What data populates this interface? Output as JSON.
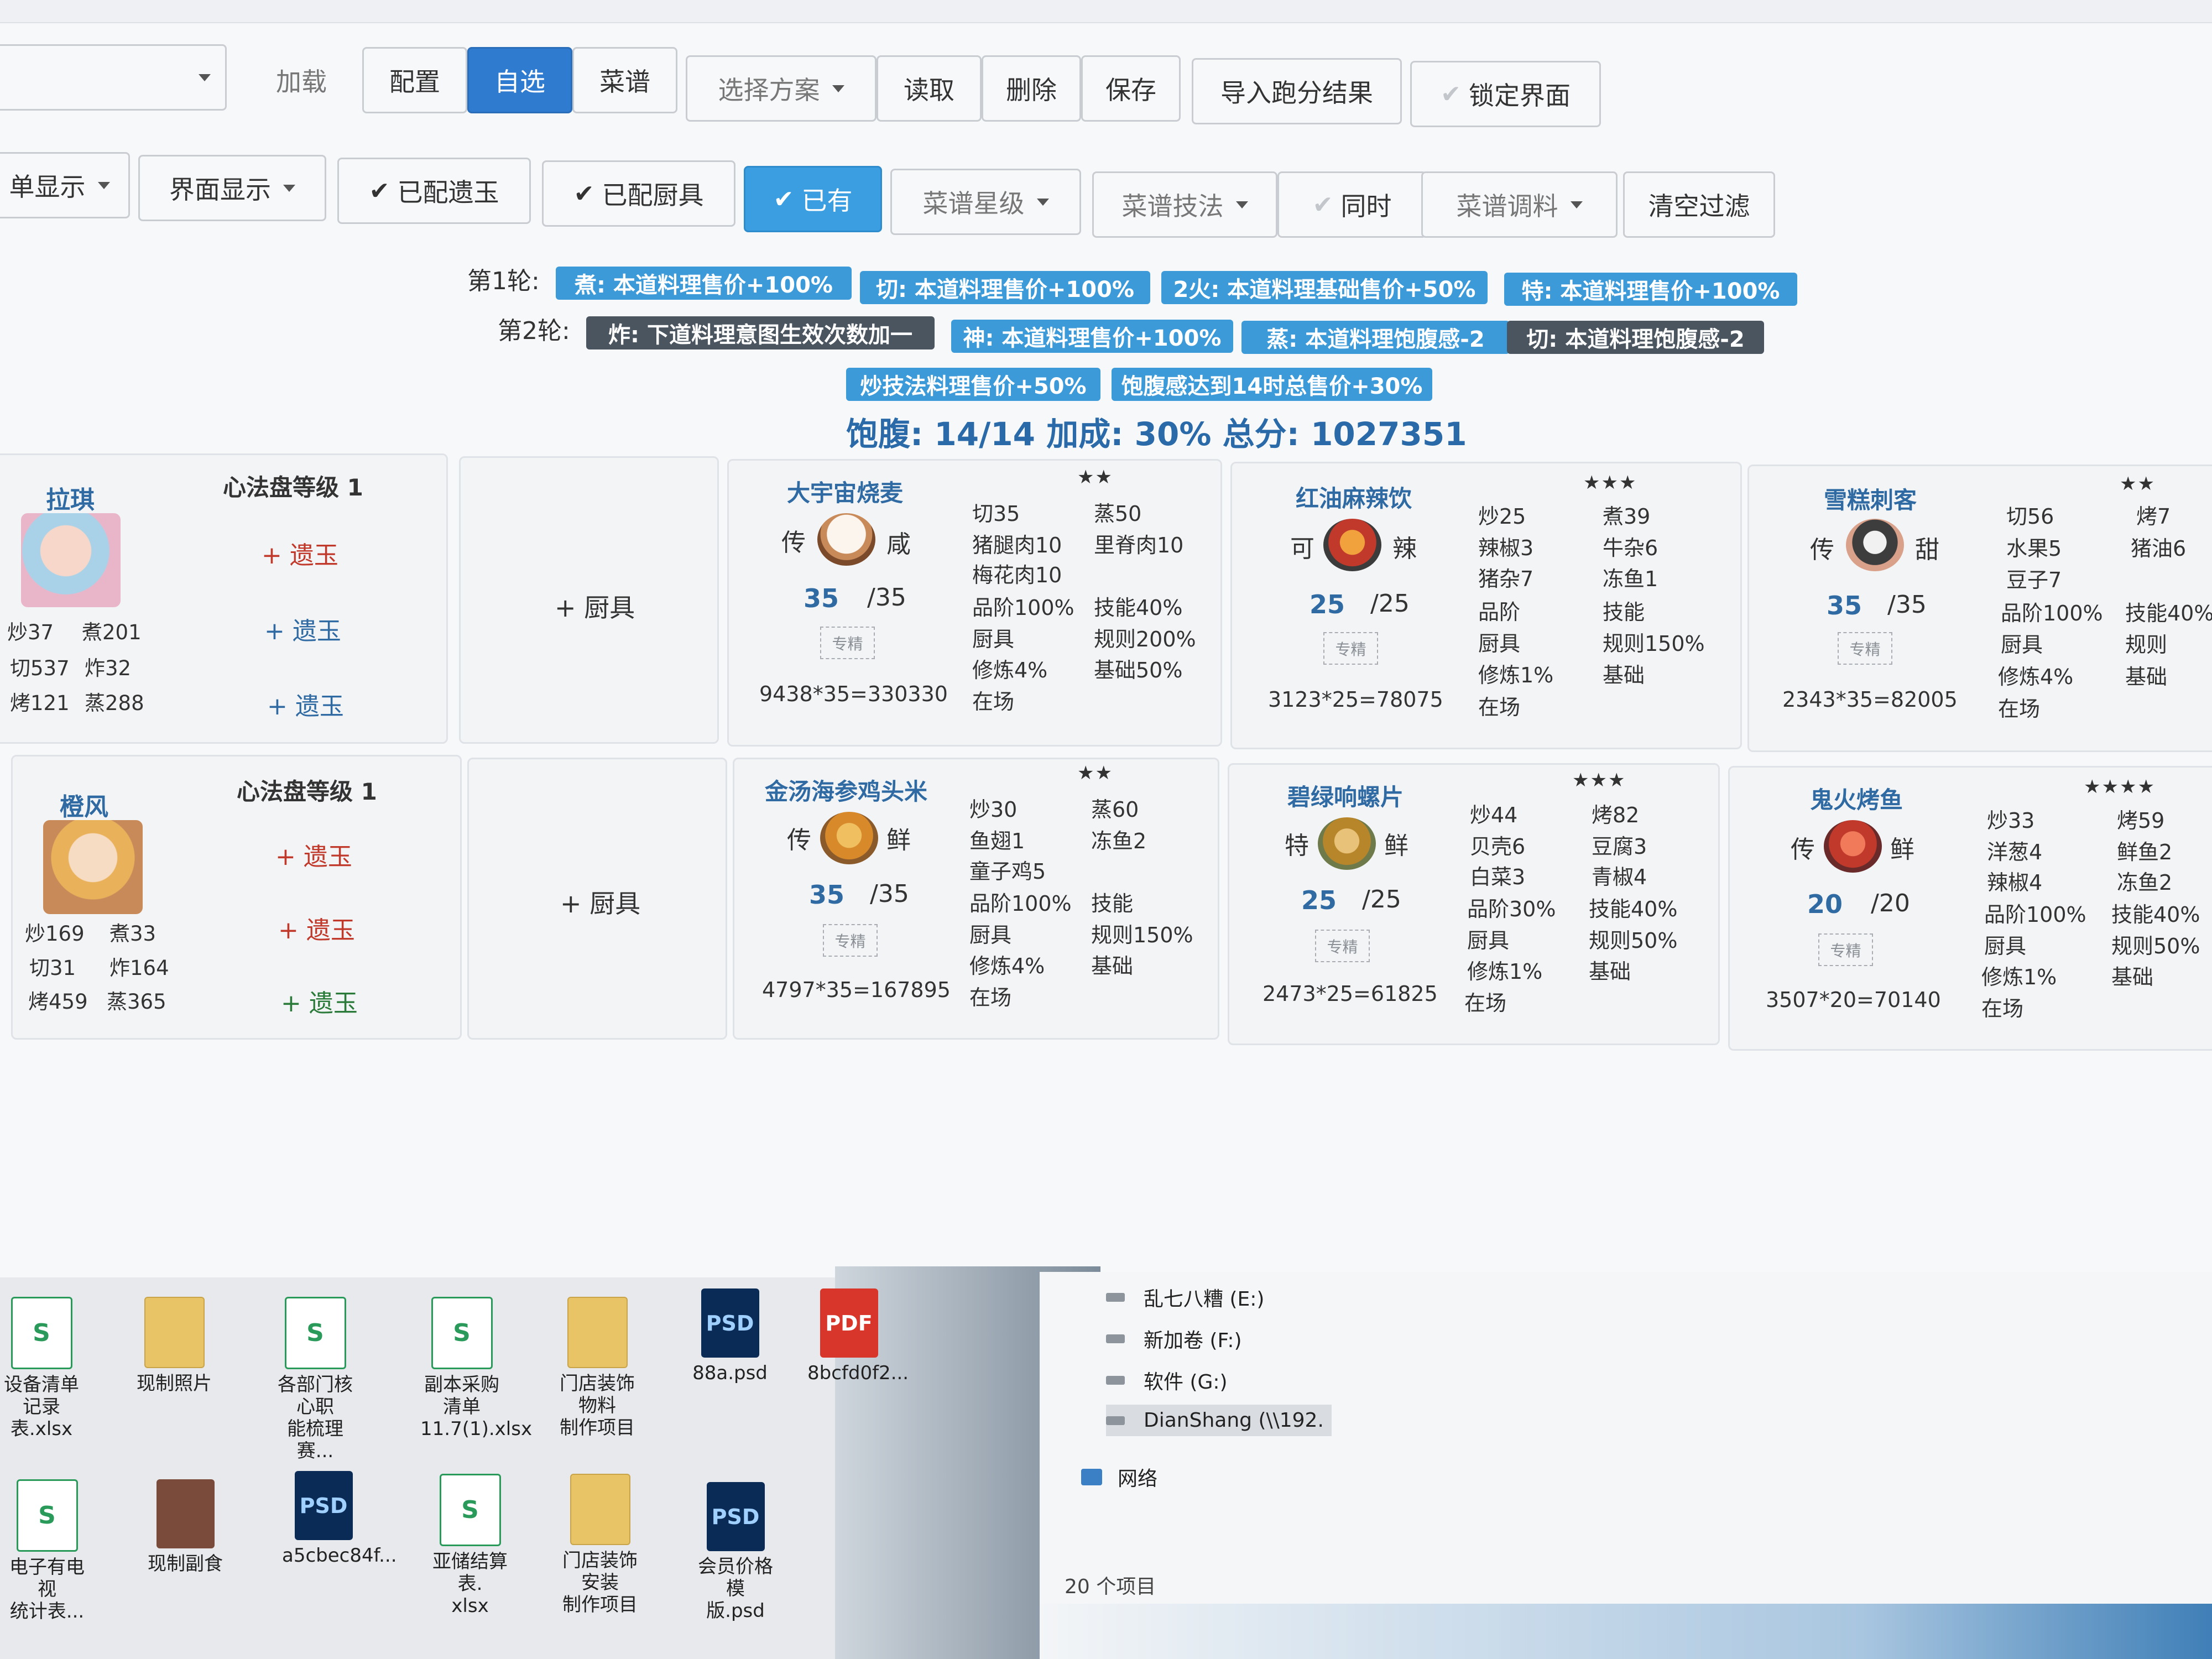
{
  "toolbar1": {
    "load": "加载",
    "config": "配置",
    "custom": "自选",
    "recipes": "菜谱",
    "choose_plan": "选择方案",
    "read": "读取",
    "delete": "删除",
    "save": "保存",
    "import_result": "导入跑分结果",
    "lock_ui": "锁定界面"
  },
  "toolbar2": {
    "menu_display": "单显示",
    "ui_display": "界面显示",
    "with_jade": "已配遗玉",
    "with_tools": "已配厨具",
    "owned": "已有",
    "recipe_stars": "菜谱星级",
    "recipe_skill": "菜谱技法",
    "simultaneous": "同时",
    "recipe_seasoning": "菜谱调料",
    "clear_filter": "清空过滤"
  },
  "rounds": {
    "round1_label": "第1轮:",
    "round1_tags": [
      "煮: 本道料理售价+100%",
      "切: 本道料理售价+100%",
      "2火: 本道料理基础售价+50%",
      "特: 本道料理售价+100%"
    ],
    "round2_label": "第2轮:",
    "round2_tags": [
      "炸: 下道料理意图生效次数加一",
      "神: 本道料理售价+100%",
      "蒸: 本道料理饱腹感-2",
      "切: 本道料理饱腹感-2"
    ],
    "round3_tags": [
      "炒技法料理售价+50%",
      "饱腹感达到14时总售价+30%"
    ]
  },
  "summary": {
    "fullness_label": "饱腹:",
    "fullness": "14/14",
    "bonus_label": "加成:",
    "bonus": "30%",
    "total_label": "总分:",
    "total": "1027351"
  },
  "chefs": [
    {
      "name": "拉琪",
      "level_label": "心法盘等级 1",
      "stats": [
        "炒37",
        "煮201",
        "切537",
        "炸32",
        "烤121",
        "蒸288"
      ],
      "gem_slots": [
        "遗玉",
        "遗玉",
        "遗玉"
      ],
      "add_tool": "+ 厨具",
      "dishes": [
        {
          "name": "大宇宙烧麦",
          "stars": "★★",
          "grade": "传",
          "taste": "咸",
          "qty": "35",
          "max": "/35",
          "calc": "9438*35=330330",
          "c1": [
            "切35",
            "猪腿肉10",
            "梅花肉10",
            "品阶100%",
            "厨具",
            "修炼4%",
            "在场"
          ],
          "c2": [
            "蒸50",
            "里脊肉10",
            "",
            "技能40%",
            "规则200%",
            "基础50%",
            ""
          ]
        },
        {
          "name": "红油麻辣饮",
          "stars": "★★★",
          "grade": "可",
          "taste": "辣",
          "qty": "25",
          "max": "/25",
          "calc": "3123*25=78075",
          "c1": [
            "炒25",
            "辣椒3",
            "猪杂7",
            "品阶",
            "厨具",
            "修炼1%",
            "在场"
          ],
          "c2": [
            "煮39",
            "牛杂6",
            "冻鱼1",
            "技能",
            "规则150%",
            "基础",
            ""
          ]
        },
        {
          "name": "雪糕刺客",
          "stars": "★★",
          "grade": "传",
          "taste": "甜",
          "qty": "35",
          "max": "/35",
          "calc": "2343*35=82005",
          "c1": [
            "切56",
            "水果5",
            "豆子7",
            "品阶100%",
            "厨具",
            "修炼4%",
            "在场"
          ],
          "c2": [
            "烤7",
            "猪油6",
            "",
            "技能40%",
            "规则",
            "基础",
            ""
          ]
        }
      ]
    },
    {
      "name": "橙风",
      "level_label": "心法盘等级 1",
      "stats": [
        "炒169",
        "煮33",
        "切31",
        "炸164",
        "烤459",
        "蒸365"
      ],
      "gem_slots": [
        "遗玉",
        "遗玉",
        "遗玉"
      ],
      "add_tool": "+ 厨具",
      "dishes": [
        {
          "name": "金汤海参鸡头米",
          "stars": "★★",
          "grade": "传",
          "taste": "鲜",
          "qty": "35",
          "max": "/35",
          "calc": "4797*35=167895",
          "c1": [
            "炒30",
            "鱼翅1",
            "童子鸡5",
            "品阶100%",
            "厨具",
            "修炼4%",
            "在场"
          ],
          "c2": [
            "蒸60",
            "冻鱼2",
            "",
            "技能",
            "规则150%",
            "基础",
            ""
          ]
        },
        {
          "name": "碧绿响螺片",
          "stars": "★★★",
          "grade": "特",
          "taste": "鲜",
          "qty": "25",
          "max": "/25",
          "calc": "2473*25=61825",
          "c1": [
            "炒44",
            "贝壳6",
            "白菜3",
            "品阶30%",
            "厨具",
            "修炼1%",
            "在场"
          ],
          "c2": [
            "烤82",
            "豆腐3",
            "青椒4",
            "技能40%",
            "规则50%",
            "基础",
            ""
          ]
        },
        {
          "name": "鬼火烤鱼",
          "stars": "★★★★",
          "grade": "传",
          "taste": "鲜",
          "qty": "20",
          "max": "/20",
          "calc": "3507*20=70140",
          "c1": [
            "炒33",
            "洋葱4",
            "辣椒4",
            "品阶100%",
            "厨具",
            "修炼1%",
            "在场"
          ],
          "c2": [
            "烤59",
            "鲜鱼2",
            "冻鱼2",
            "技能40%",
            "规则50%",
            "基础",
            ""
          ]
        }
      ]
    }
  ],
  "dish_stamp": "专精",
  "desktop": {
    "icons_row1": [
      "设备清单\n记录表.xlsx",
      "现制照片",
      "各部门核心职\n能梳理 赛...",
      "副本采购清单\n11.7(1).xlsx",
      "门店装饰物料\n制作项目",
      "88a.psd",
      "8bcfd0f2..."
    ],
    "icons_row2": [
      "电子有电视\n统计表...",
      "现制副食",
      "a5cbec84f...",
      "亚储结算表.\nxlsx",
      "门店装饰安装\n制作项目",
      "会员价格模\n版.psd"
    ]
  },
  "explorer": {
    "drives": [
      "乱七八糟 (E:)",
      "新加卷 (F:)",
      "软件 (G:)",
      "DianShang (\\\\192."
    ],
    "network": "网络",
    "item_count": "20 个项目"
  },
  "colors": {
    "accent_blue": "#2f7bd0",
    "tag_blue": "#3d9ad8",
    "tag_dark": "#4a5560",
    "name_blue": "#2f6aa3",
    "gem_red": "#c0392b"
  }
}
